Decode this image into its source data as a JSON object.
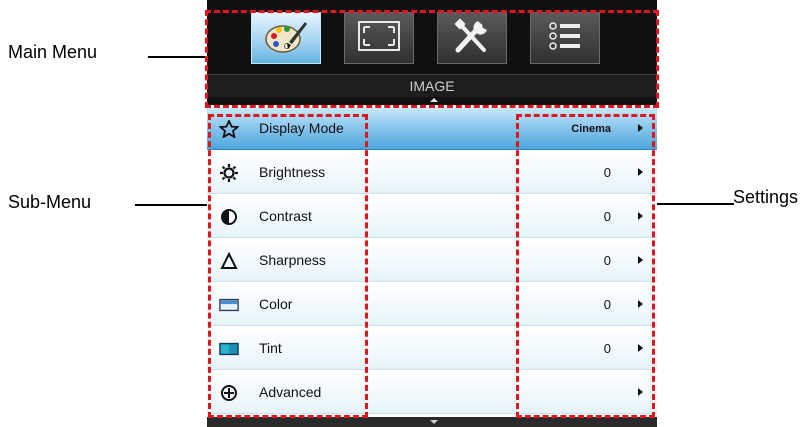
{
  "callouts": {
    "main_menu": "Main Menu",
    "sub_menu": "Sub-Menu",
    "settings": "Settings"
  },
  "osd": {
    "title": "IMAGE",
    "tabs": [
      {
        "icon": "palette-icon",
        "active": true
      },
      {
        "icon": "screen-frame-icon",
        "active": false
      },
      {
        "icon": "tools-icon",
        "active": false
      },
      {
        "icon": "list-icon",
        "active": false
      }
    ],
    "items": [
      {
        "label": "Display Mode",
        "value": "Cinema",
        "icon": "star-icon"
      },
      {
        "label": "Brightness",
        "value": "0",
        "icon": "sun-icon"
      },
      {
        "label": "Contrast",
        "value": "0",
        "icon": "contrast-icon"
      },
      {
        "label": "Sharpness",
        "value": "0",
        "icon": "delta-icon"
      },
      {
        "label": "Color",
        "value": "0",
        "icon": "color-swatch-icon"
      },
      {
        "label": "Tint",
        "value": "0",
        "icon": "tint-swatch-icon"
      },
      {
        "label": "Advanced",
        "value": "",
        "icon": "plus-circle-icon"
      }
    ]
  },
  "colors": {
    "highlight": "#e0161d",
    "active_row": "#4ea6dd",
    "osd_background": "#101010"
  }
}
